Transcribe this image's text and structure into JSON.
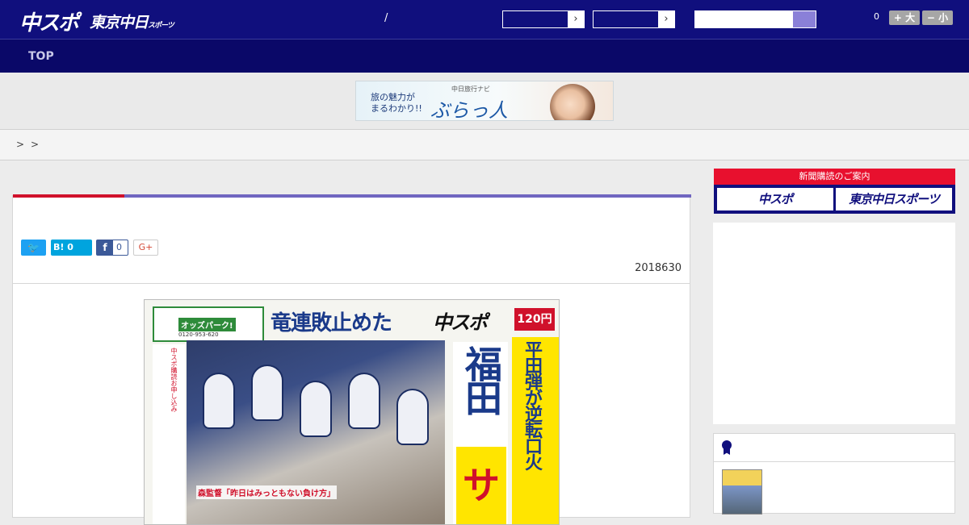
{
  "header": {
    "logo_chuspo": "中スポ",
    "logo_tokyo": "東京中日",
    "logo_tokyo_small": "スポーツ",
    "slash": "/",
    "select_arrow": "›",
    "font_count": "0",
    "font_plus": "+ 大",
    "font_minus": "− 小",
    "search_placeholder": ""
  },
  "nav": {
    "top": "TOP"
  },
  "ad": {
    "line1": "旅の魅力が",
    "line2": "まるわかり!!",
    "sub": "中日旅行ナビ",
    "brand": "ぶらっ人"
  },
  "breadcrumb": {
    "sep1": ">",
    "sep2": ">"
  },
  "article": {
    "share": {
      "twitter_icon": "🐦",
      "hatena_label": "B! 0",
      "facebook_icon": "f",
      "facebook_count": "0",
      "gplus": "G+"
    },
    "date": "2018630",
    "paper": {
      "ad_label": "オッズパーク!",
      "ad_tel": "0120-953-620",
      "headline": "竜連敗止めた",
      "logo": "中スポ",
      "price": "120円",
      "side_text": "中スポ購読お申し込み",
      "sub": "森監督「昨日はみっともない負け方」",
      "big": "福田",
      "sayo": "サヨ",
      "right": "平田弾が逆転口火"
    }
  },
  "sidebar": {
    "subscribe_head": "新聞購読のご案内",
    "btn_chuspo": "中スポ",
    "btn_tokyo": "東京中日スポーツ"
  }
}
